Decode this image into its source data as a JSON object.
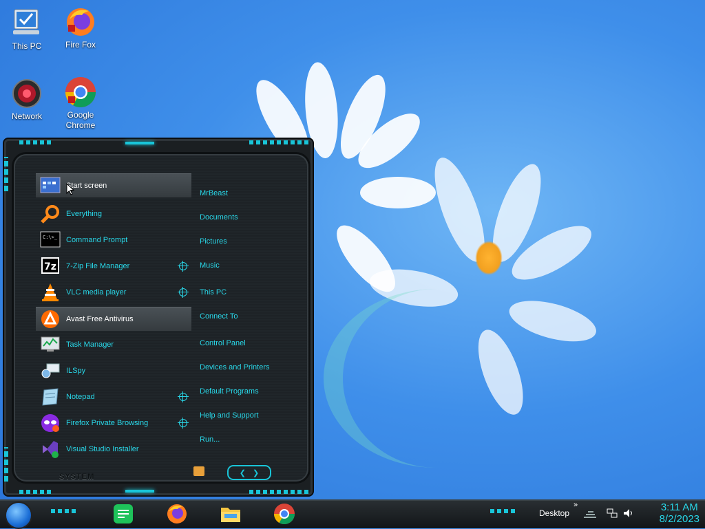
{
  "desktop": {
    "icons": [
      {
        "label": "This PC",
        "icon": "computer-icon"
      },
      {
        "label": "Fire Fox",
        "icon": "firefox-icon"
      },
      {
        "label": "Network",
        "icon": "network-icon"
      },
      {
        "label": "Google Chrome",
        "icon": "chrome-icon"
      }
    ]
  },
  "start_menu": {
    "programs": [
      {
        "label": "Start screen",
        "icon": "start-screen-icon",
        "highlighted": true,
        "pinned": false
      },
      {
        "label": "Everything",
        "icon": "search-icon",
        "highlighted": false,
        "pinned": false
      },
      {
        "label": "Command Prompt",
        "icon": "terminal-icon",
        "highlighted": false,
        "pinned": false
      },
      {
        "label": "7-Zip File Manager",
        "icon": "7zip-icon",
        "highlighted": false,
        "pinned": true
      },
      {
        "label": "VLC media player",
        "icon": "vlc-cone-icon",
        "highlighted": false,
        "pinned": true
      },
      {
        "label": "Avast Free Antivirus",
        "icon": "avast-icon",
        "highlighted": true,
        "pinned": false
      },
      {
        "label": "Task Manager",
        "icon": "task-manager-icon",
        "highlighted": false,
        "pinned": false
      },
      {
        "label": "ILSpy",
        "icon": "ilspy-icon",
        "highlighted": false,
        "pinned": false
      },
      {
        "label": "Notepad",
        "icon": "notepad-icon",
        "highlighted": false,
        "pinned": true
      },
      {
        "label": "Firefox Private Browsing",
        "icon": "firefox-private-icon",
        "highlighted": false,
        "pinned": true
      },
      {
        "label": "Visual Studio Installer",
        "icon": "visual-studio-icon",
        "highlighted": false,
        "pinned": false
      }
    ],
    "links": [
      "MrBeast",
      "Documents",
      "Pictures",
      "Music",
      "This PC",
      "Connect To",
      "Control Panel",
      "Devices and Printers",
      "Default Programs",
      "Help and Support",
      "Run..."
    ],
    "system_label": "SYSTEM",
    "nav_left": "❮",
    "nav_right": "❯"
  },
  "taskbar": {
    "apps": [
      "sheets-icon",
      "firefox-icon",
      "file-explorer-icon",
      "chrome-icon"
    ],
    "desktop_label": "Desktop",
    "overflow": "»",
    "time": "3:11 AM",
    "date": "8/2/2023"
  },
  "colors": {
    "accent": "#29d7e8",
    "menu_bg": "#1d2226",
    "highlight": "#4a5156"
  }
}
